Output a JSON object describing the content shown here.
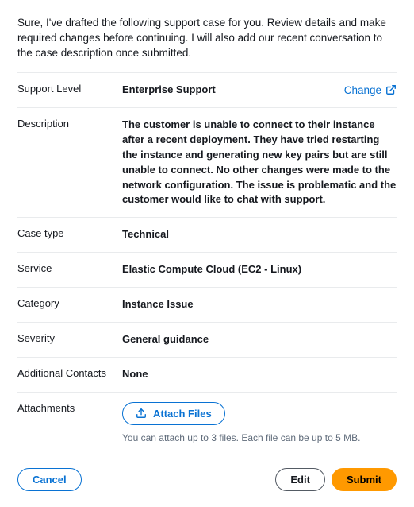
{
  "intro": "Sure, I've drafted the following support case for you. Review details and make required changes before continuing. I will also add our recent conversation to the case description once submitted.",
  "fields": {
    "support_level": {
      "label": "Support Level",
      "value": "Enterprise Support"
    },
    "description": {
      "label": "Description",
      "value": "The customer is unable to connect to their instance after a recent deployment. They have tried restarting the instance and generating new key pairs but are still unable to connect. No other changes were made to the network configuration. The issue is problematic and the customer would like to chat with support."
    },
    "case_type": {
      "label": "Case type",
      "value": "Technical"
    },
    "service": {
      "label": "Service",
      "value": "Elastic Compute Cloud (EC2 - Linux)"
    },
    "category": {
      "label": "Category",
      "value": "Instance Issue"
    },
    "severity": {
      "label": "Severity",
      "value": "General guidance"
    },
    "additional_contacts": {
      "label": "Additional Contacts",
      "value": "None"
    },
    "attachments": {
      "label": "Attachments",
      "button": "Attach Files",
      "hint": "You can attach up to 3 files. Each file can be up to 5 MB."
    }
  },
  "change_link": "Change",
  "buttons": {
    "cancel": "Cancel",
    "edit": "Edit",
    "submit": "Submit"
  }
}
